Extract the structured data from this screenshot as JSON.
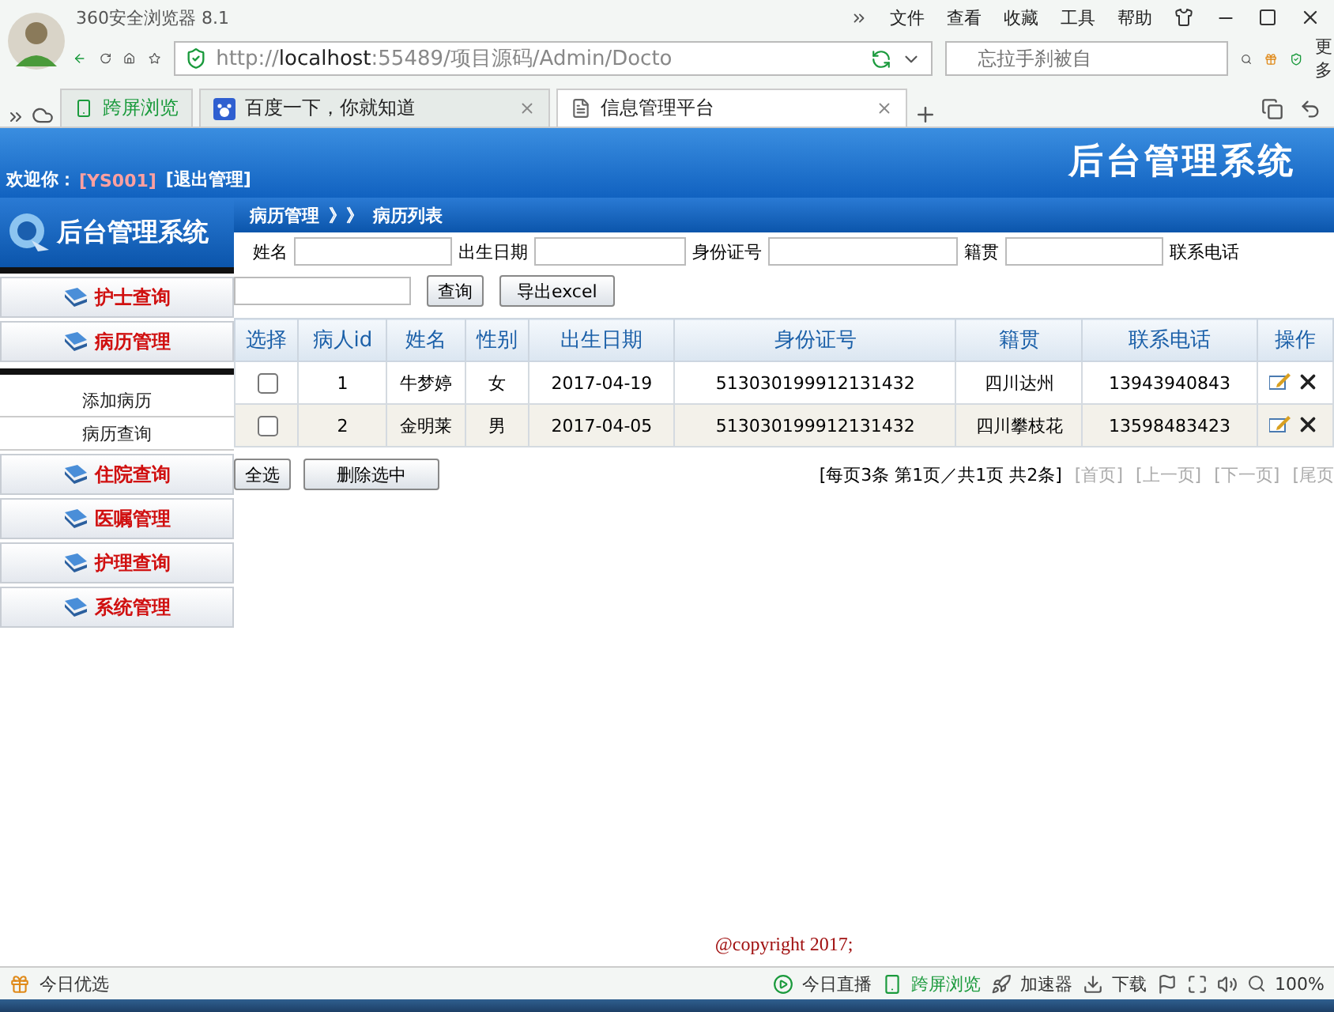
{
  "browser": {
    "title": "360安全浏览器 8.1",
    "menu": [
      "文件",
      "查看",
      "收藏",
      "工具",
      "帮助"
    ],
    "address": {
      "scheme": "http://",
      "host": "localhost",
      "rest": ":55489/项目源码/Admin/Docto"
    },
    "search": {
      "placeholder": "忘拉手刹被自"
    },
    "more": "更多",
    "tabs": [
      {
        "label": "跨屏浏览",
        "kind": "pinned",
        "selected": false
      },
      {
        "label": "百度一下，你就知道",
        "kind": "paw",
        "selected": false
      },
      {
        "label": "信息管理平台",
        "kind": "page",
        "selected": true
      }
    ]
  },
  "header": {
    "welcome": "欢迎你：",
    "user": "[YS001]",
    "logout": "[退出管理]",
    "title": "后台管理系统"
  },
  "sidebar": {
    "title": "后台管理系统",
    "groups": [
      {
        "label": "护士查询"
      },
      {
        "label": "病历管理",
        "children": [
          {
            "label": "添加病历"
          },
          {
            "label": "病历查询"
          }
        ]
      },
      {
        "label": "住院查询"
      },
      {
        "label": "医嘱管理"
      },
      {
        "label": "护理查询"
      },
      {
        "label": "系统管理"
      }
    ]
  },
  "breadcrumb": {
    "section": "病历管理",
    "separator": "》》",
    "page": "病历列表"
  },
  "filters": [
    {
      "label": "姓名"
    },
    {
      "label": "出生日期"
    },
    {
      "label": "身份证号"
    },
    {
      "label": "籍贯"
    },
    {
      "label": "联系电话"
    }
  ],
  "actions": {
    "search": "查询",
    "export": "导出excel"
  },
  "table": {
    "columns": [
      "选择",
      "病人id",
      "姓名",
      "性别",
      "出生日期",
      "身份证号",
      "籍贯",
      "联系电话",
      "操作"
    ],
    "rows": [
      {
        "checked": false,
        "cells": [
          "",
          "1",
          "牛梦婷",
          "女",
          "2017-04-19",
          "513030199912131432",
          "四川达州",
          "13943940843"
        ]
      },
      {
        "checked": false,
        "cells": [
          "",
          "2",
          "金明莱",
          "男",
          "2017-04-05",
          "513030199912131432",
          "四川攀枝花",
          "13598483423"
        ]
      }
    ]
  },
  "footer": {
    "select_all": "全选",
    "delete": "删除选中",
    "pager": "[每页3条 第1页／共1页 共2条]",
    "links": [
      "[首页]",
      "[上一页]",
      "[下一页]",
      "[尾页"
    ]
  },
  "copyright": "@copyright 2017;",
  "status_bar": {
    "left": "今日优选",
    "items": [
      "今日直播",
      "跨屏浏览",
      "加速器",
      "下载"
    ],
    "zoom": "100%"
  }
}
